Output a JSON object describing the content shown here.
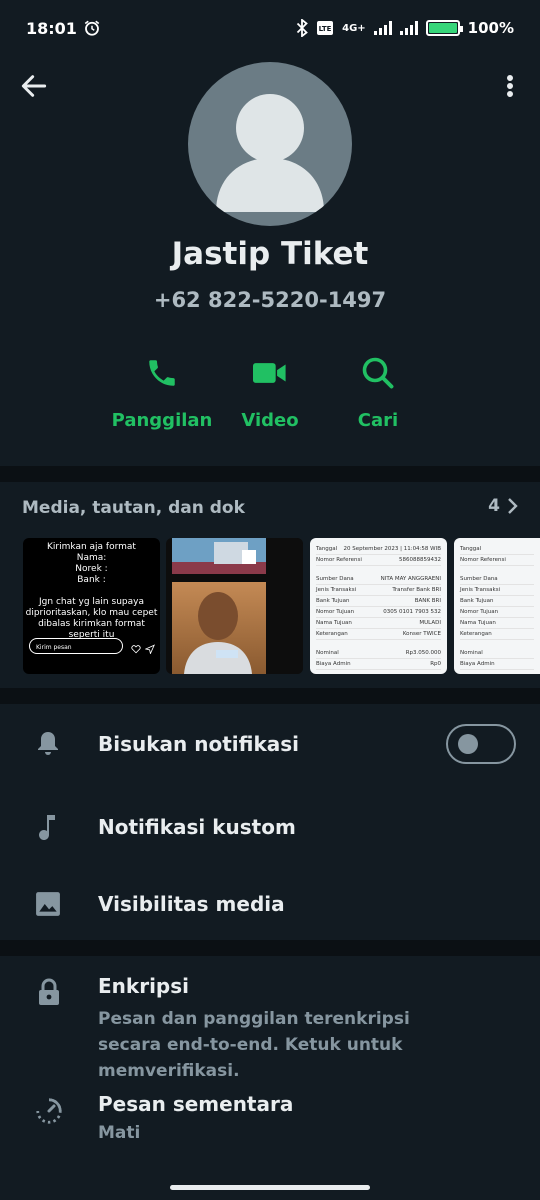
{
  "status_bar": {
    "time": "18:01",
    "network": "4G+",
    "battery": "100%"
  },
  "contact": {
    "name": "Jastip Tiket",
    "phone": "+62 822-5220-1497"
  },
  "actions": [
    {
      "label": "Panggilan",
      "icon": "phone-icon"
    },
    {
      "label": "Video",
      "icon": "video-icon"
    },
    {
      "label": "Cari",
      "icon": "search-icon"
    }
  ],
  "media": {
    "title": "Media, tautan, dan dok",
    "count": "4",
    "thumb1": {
      "lines": [
        "Kirimkan aja format",
        "Nama:",
        "Norek :",
        "Bank :",
        "",
        "Jgn chat yg lain supaya",
        "diprioritaskan, klo mau cepet",
        "dibalas kirimkan format seperti itu"
      ],
      "reply": "Kirim pesan"
    },
    "receipt": {
      "rows": [
        [
          "Tanggal",
          "20 September 2023 | 11:04:58 WIB"
        ],
        [
          "Nomor Referensi",
          "586088859432"
        ],
        [
          "Sumber Dana",
          "NITA MAY ANGGRAENI"
        ],
        [
          "Jenis Transaksi",
          "Transfer Bank BRI"
        ],
        [
          "Bank Tujuan",
          "BANK BRI"
        ],
        [
          "Nomor Tujuan",
          "0305 0101 7903 532"
        ],
        [
          "Nama Tujuan",
          "MULADI"
        ],
        [
          "Keterangan",
          "Konser TWICE"
        ],
        [
          "Nominal",
          "Rp3.050.000"
        ],
        [
          "Biaya Admin",
          "Rp0"
        ]
      ]
    }
  },
  "settings": {
    "mute": "Bisukan notifikasi",
    "custom": "Notifikasi kustom",
    "visibility": "Visibilitas media"
  },
  "encryption": {
    "title": "Enkripsi",
    "subtitle": "Pesan dan panggilan terenkripsi secara end-to-end. Ketuk untuk memverifikasi."
  },
  "disappearing": {
    "title": "Pesan sementara",
    "value": "Mati"
  },
  "colors": {
    "accent": "#21c063",
    "background": "#121b22"
  }
}
